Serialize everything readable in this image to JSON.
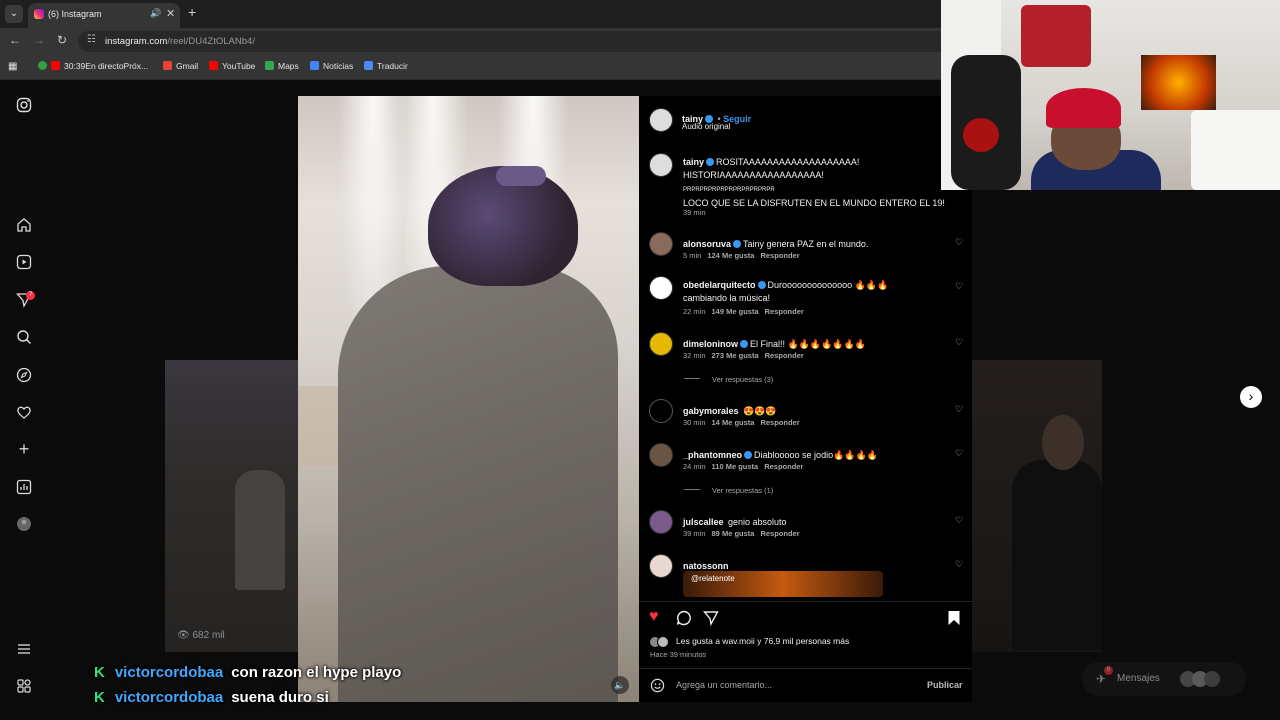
{
  "browser": {
    "tab_title": "(6) Instagram",
    "url_host": "instagram.com",
    "url_path": "/reel/DU4ZtOLANb4/",
    "bookmarks": [
      "30:39En directoPróx...",
      "Gmail",
      "YouTube",
      "Maps",
      "Noticias",
      "Traducir"
    ]
  },
  "sidebar": {
    "notifications_badge": "7"
  },
  "background_reels": {
    "left_views": "682 mil"
  },
  "post": {
    "author": "tainy",
    "follow_label": "Seguir",
    "audio": "Audio original",
    "caption_lines": [
      "ROSITAAAAAAAAAAAAAAAAAAA!",
      "HISTORIAAAAAAAAAAAAAAAAA!",
      "PRPRPRPRPRPRPRPRPRPRPR",
      "LOCO QUE SE LA DISFRUTEN EN EL MUNDO ENTERO EL 19!"
    ],
    "caption_time": "39 min",
    "likes_text": "Les gusta a wav.moii y 76,9 mil personas más",
    "posted_ago": "Hace 39 minutos",
    "comment_placeholder": "Agrega un comentario...",
    "publish_label": "Publicar"
  },
  "comments": [
    {
      "user": "alonsoruva",
      "verified": true,
      "text": "Tainy genera PAZ en el mundo.",
      "time": "5 min",
      "likes": "124 Me gusta",
      "reply": "Responder"
    },
    {
      "user": "obedelarquitecto",
      "verified": true,
      "text": "Duroooooooooooooo 🔥🔥🔥",
      "text2": "cambiando la música!",
      "time": "22 min",
      "likes": "149 Me gusta",
      "reply": "Responder"
    },
    {
      "user": "dimeloninow",
      "verified": true,
      "text": "El Final!! 🔥🔥🔥🔥🔥🔥🔥",
      "time": "32 min",
      "likes": "273 Me gusta",
      "reply": "Responder",
      "replies": "Ver respuestas (3)"
    },
    {
      "user": "gabymorales",
      "verified": false,
      "text": "😍😍😍",
      "time": "30 min",
      "likes": "14 Me gusta",
      "reply": "Responder"
    },
    {
      "user": "_phantomneo",
      "verified": true,
      "text": "Diablooooo se jodio🔥🔥🔥🔥",
      "time": "24 min",
      "likes": "110 Me gusta",
      "reply": "Responder",
      "replies": "Ver respuestas (1)"
    },
    {
      "user": "julscallee",
      "verified": false,
      "text": "genio absoluto",
      "time": "39 min",
      "likes": "89 Me gusta",
      "reply": "Responder"
    },
    {
      "user": "natossonn",
      "verified": false,
      "sticker": "@relatenote"
    }
  ],
  "chat": [
    {
      "user": "victorcordobaa",
      "message": "con razon el hype playo"
    },
    {
      "user": "victorcordobaa",
      "message": "suena duro si"
    }
  ],
  "messages_pill": {
    "label": "Mensajes",
    "badge": "6"
  },
  "colors": {
    "like_red": "#ff3040",
    "link_blue": "#3897f0",
    "chat_user": "#41a8ff",
    "chat_badge": "#35e07a"
  }
}
